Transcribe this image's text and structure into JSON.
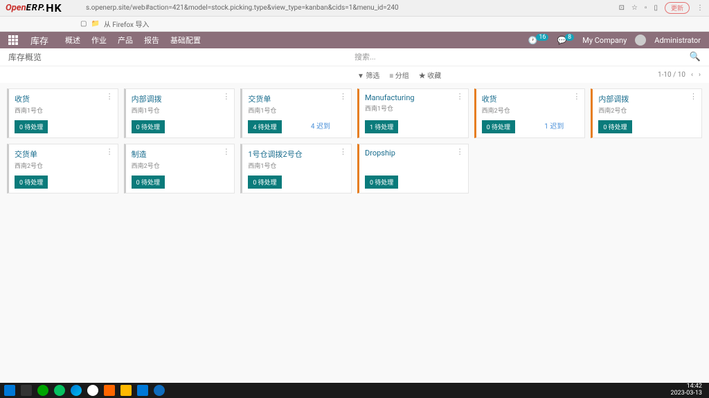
{
  "browser": {
    "logo_open": "Open",
    "logo_erp": "ERP.",
    "logo_hk": "HK",
    "url": "s.openerp.site/web#action=421&model=stock.picking.type&view_type=kanban&cids=1&menu_id=240",
    "refresh": "更新",
    "bookmark_folder": "从 Firefox 导入"
  },
  "nav": {
    "title": "库存",
    "menu": [
      "概述",
      "作业",
      "产品",
      "报告",
      "基础配置"
    ],
    "badge1": "16",
    "badge2": "8",
    "company": "My Company",
    "user": "Administrator"
  },
  "page": {
    "title": "库存概览",
    "search_placeholder": "搜索...",
    "filters": [
      "▼ 筛选",
      "≡ 分组",
      "★ 收藏"
    ],
    "pager": "1-10 / 10"
  },
  "cards": [
    {
      "title": "收货",
      "sub": "西南1号仓",
      "btn": "0 待处理",
      "accent": false
    },
    {
      "title": "内部调拨",
      "sub": "西南1号仓",
      "btn": "0 待处理",
      "accent": false
    },
    {
      "title": "交货单",
      "sub": "西南1号仓",
      "btn": "4 待处理",
      "extra": "4 迟到",
      "accent": false
    },
    {
      "title": "Manufacturing",
      "sub": "西南1号仓",
      "btn": "1 待处理",
      "accent": true
    },
    {
      "title": "收货",
      "sub": "西南2号仓",
      "btn": "0 待处理",
      "extra": "1 迟到",
      "accent": true
    },
    {
      "title": "内部调拨",
      "sub": "西南2号仓",
      "btn": "0 待处理",
      "accent": true
    },
    {
      "title": "交货单",
      "sub": "西南2号仓",
      "btn": "0 待处理",
      "accent": false
    },
    {
      "title": "制造",
      "sub": "西南2号仓",
      "btn": "0 待处理",
      "accent": false
    },
    {
      "title": "1号仓调拨2号仓",
      "sub": "西南1号仓",
      "btn": "0 待处理",
      "accent": false
    },
    {
      "title": "Dropship",
      "sub": "",
      "btn": "0 待处理",
      "accent": true
    }
  ],
  "taskbar": {
    "time": "14:42",
    "date": "2023-03-13"
  }
}
